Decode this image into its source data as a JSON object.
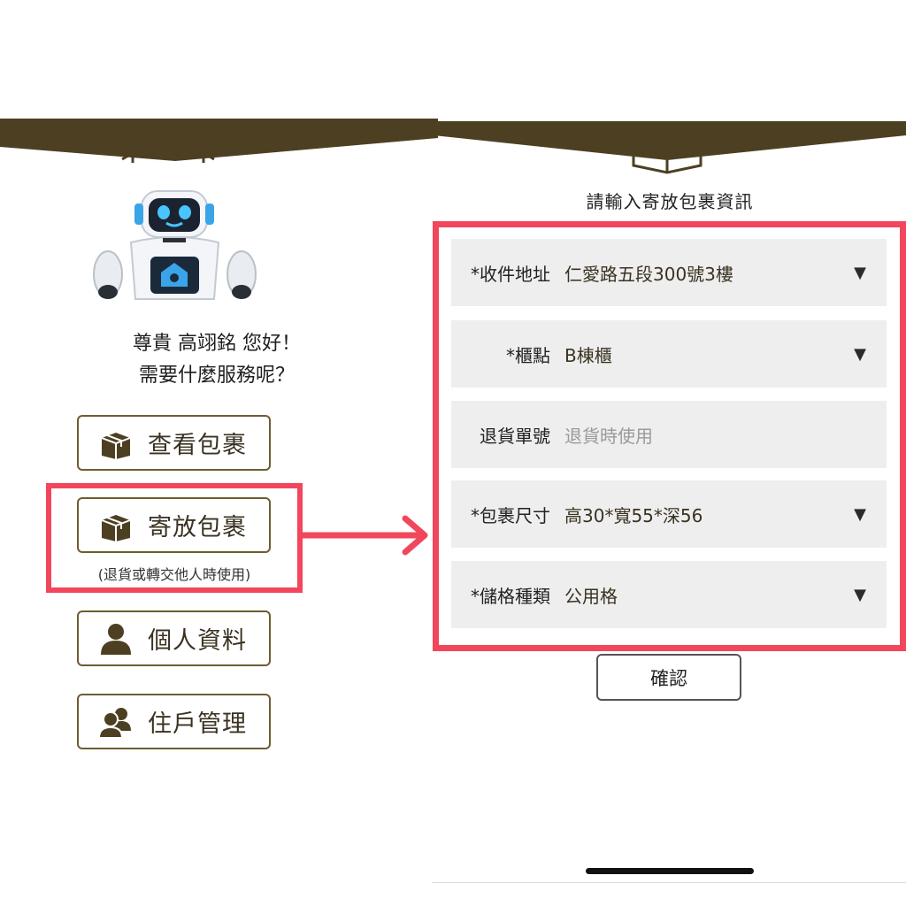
{
  "colors": {
    "header_brown": "#4d4022",
    "button_border": "#6f5c32",
    "highlight_red": "#f2465c",
    "row_bg": "#eeeeee"
  },
  "left_screen": {
    "greeting_line1": "尊貴  高翊銘  您好！",
    "greeting_line2": "需要什麼服務呢？",
    "menu": [
      {
        "label": "查看包裹",
        "icon": "package-icon"
      },
      {
        "label": "寄放包裹",
        "icon": "package-icon",
        "note": "(退貨或轉交他人時使用)"
      },
      {
        "label": "個人資料",
        "icon": "user-icon"
      },
      {
        "label": "住戶管理",
        "icon": "users-icon"
      }
    ]
  },
  "right_screen": {
    "title": "請輸入寄放包裹資訊",
    "fields": [
      {
        "label": "*收件地址",
        "value": "仁愛路五段300號3樓",
        "dropdown": "▼"
      },
      {
        "label": "*櫃點",
        "value": "B棟櫃",
        "dropdown": "▼"
      },
      {
        "label": "退貨單號",
        "placeholder": "退貨時使用"
      },
      {
        "label": "*包裹尺寸",
        "value": "高30*寬55*深56",
        "dropdown": "▼"
      },
      {
        "label": "*儲格種類",
        "value": "公用格",
        "dropdown": "▼"
      }
    ],
    "confirm_label": "確認"
  }
}
